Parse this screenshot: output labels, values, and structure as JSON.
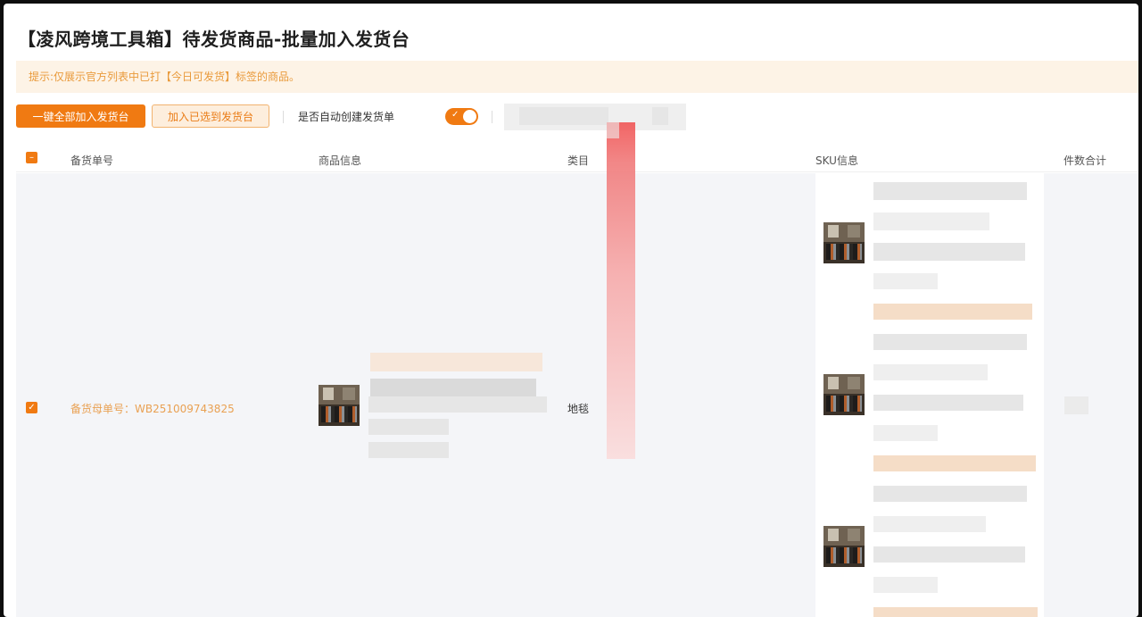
{
  "title": "【凌风跨境工具箱】待发货商品-批量加入发货台",
  "notice": "提示:仅展示官方列表中已打【今日可发货】标签的商品。",
  "toolbar": {
    "add_all_label": "一键全部加入发货台",
    "add_selected_label": "加入已选到发货台",
    "auto_create_label": "是否自动创建发货单",
    "auto_create_enabled": true
  },
  "table": {
    "columns": [
      "备货单号",
      "商品信息",
      "类目",
      "SKU信息",
      "件数合计"
    ],
    "rows": [
      {
        "selected": true,
        "order_no": "备货母单号：WB251009743825",
        "category": "地毯"
      }
    ]
  },
  "colors": {
    "accent": "#f07a12",
    "notice_bg": "#fdf3e6",
    "notice_text": "#e99a3b",
    "order_no_text": "#e9a153"
  },
  "icons": {
    "header_checkbox": "indeterminate-checkbox-icon",
    "row_checkbox": "checked-checkbox-icon",
    "toggle": "toggle-on-icon"
  }
}
